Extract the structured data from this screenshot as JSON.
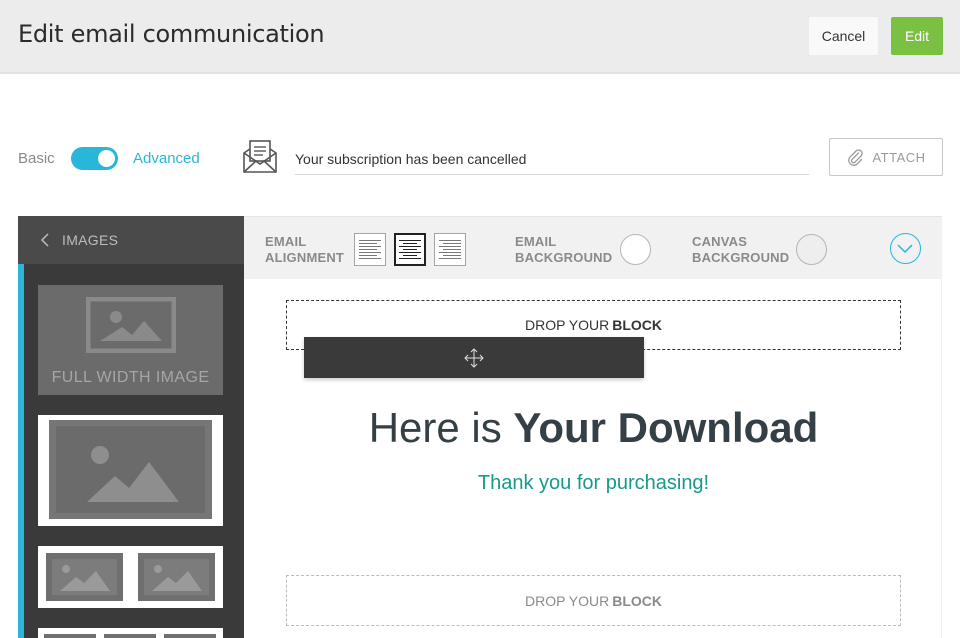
{
  "header": {
    "title": "Edit email communication",
    "cancel_label": "Cancel",
    "edit_label": "Edit",
    "edit_color": "#7ac143"
  },
  "mode": {
    "basic_label": "Basic",
    "advanced_label": "Advanced",
    "advanced_enabled": true,
    "accent_color": "#29b6d8"
  },
  "subject": {
    "value": "Your subscription has been cancelled",
    "icon": "envelope-icon"
  },
  "attach": {
    "label": "ATTACH",
    "icon": "paperclip-icon"
  },
  "sidebar": {
    "title": "IMAGES",
    "back_icon": "chevron-left-icon",
    "blocks": [
      {
        "label": "FULL WIDTH IMAGE"
      }
    ]
  },
  "toolbar": {
    "email_alignment_line1": "EMAIL",
    "email_alignment_line2": "ALIGNMENT",
    "email_background_line1": "EMAIL",
    "email_background_line2": "BACKGROUND",
    "canvas_background_line1": "CANVAS",
    "canvas_background_line2": "BACKGROUND",
    "alignment_selected": "center",
    "email_background_color": "#ffffff",
    "canvas_background_color": "#eeeeee"
  },
  "canvas": {
    "drop_text": "DROP YOUR",
    "drop_bold": "BLOCK",
    "heading_regular": "Here is",
    "heading_bold": "Your Download",
    "subheading": "Thank you for purchasing!",
    "subheading_color": "#179a8a"
  }
}
